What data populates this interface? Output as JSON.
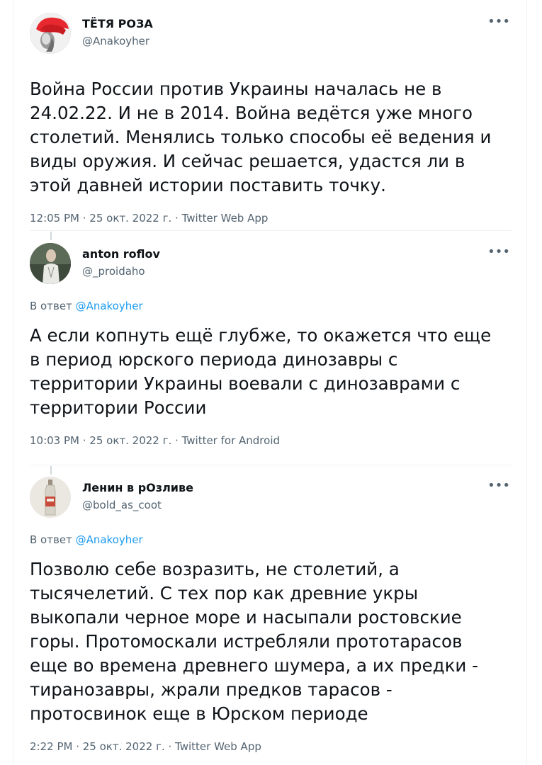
{
  "tweets": [
    {
      "author": "ТЁТЯ РОЗА",
      "handle": "@Anakoyher",
      "reply_prefix": "",
      "reply_mention": "",
      "text": "Война России против Украины началась не в 24.02.22. И не в 2014. Война ведётся уже много столетий. Менялись только способы её ведения и виды оружия. И сейчас решается, удастся ли в этой давней истории поставить точку.",
      "time": "12:05 PM",
      "date": "25 окт. 2022 г.",
      "source": "Twitter Web App"
    },
    {
      "author": "anton roflov",
      "handle": "@_proidaho",
      "reply_prefix": "В ответ",
      "reply_mention": "@Anakoyher",
      "text": "А если копнуть ещё глубже, то окажется что еще в период юрского периода динозавры с территории Украины воевали с динозаврами с территории России",
      "time": "10:03 PM",
      "date": "25 окт. 2022 г.",
      "source": "Twitter for Android"
    },
    {
      "author": "Ленин в рОзливе",
      "handle": "@bold_as_coot",
      "reply_prefix": "В ответ",
      "reply_mention": "@Anakoyher",
      "text": "Позволю себе возразить, не столетий, а тысячелетий. С тех пор как древние укры выкопали черное море и насыпали ростовские горы. Протомоскали истребляли прототарасов еще во времена древнего шумера, а их предки - тиранозавры, жрали предков тарасов - протосвинок еще в Юрском периоде",
      "time": "2:22 PM",
      "date": "25 окт. 2022 г.",
      "source": "Twitter Web App"
    }
  ],
  "icons": {
    "more": "more-horizontal-icon",
    "separator": " · "
  },
  "colors": {
    "link": "#1d9bf0",
    "secondary_text": "#536471",
    "divider": "#eff3f4"
  }
}
